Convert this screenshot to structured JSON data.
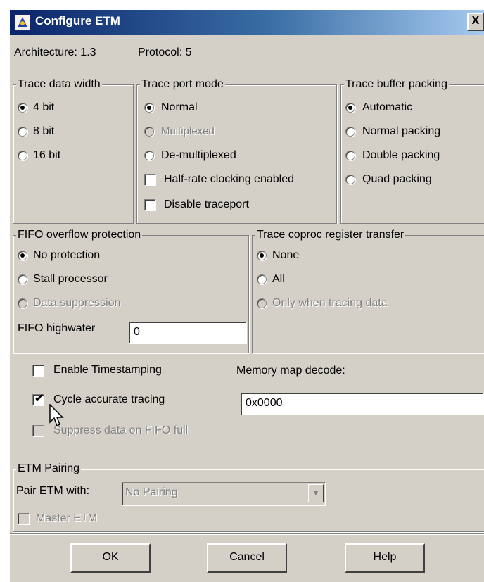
{
  "window": {
    "title": "Configure ETM",
    "close_glyph": "X"
  },
  "info": {
    "architecture": "Architecture: 1.3",
    "protocol": "Protocol: 5"
  },
  "trace_data_width": {
    "legend": "Trace data width",
    "options": [
      "4 bit",
      "8 bit",
      "16 bit"
    ]
  },
  "trace_port_mode": {
    "legend": "Trace port mode",
    "options": [
      "Normal",
      "Multiplexed",
      "De-multiplexed"
    ],
    "half_rate": "Half-rate clocking enabled",
    "disable_traceport": "Disable traceport"
  },
  "trace_buffer_packing": {
    "legend": "Trace buffer packing",
    "options": [
      "Automatic",
      "Normal packing",
      "Double packing",
      "Quad packing"
    ]
  },
  "fifo": {
    "legend": "FIFO overflow protection",
    "options": [
      "No protection",
      "Stall processor",
      "Data suppression"
    ],
    "highwater_label": "FIFO highwater",
    "highwater_value": "0"
  },
  "coproc": {
    "legend": "Trace coproc register transfer",
    "options": [
      "None",
      "All",
      "Only when tracing data"
    ]
  },
  "misc": {
    "enable_timestamping": "Enable Timestamping",
    "cycle_accurate": "Cycle accurate tracing",
    "suppress_data": "Suppress data on FIFO full",
    "memory_map_label": "Memory map decode:",
    "memory_map_value": "0x0000"
  },
  "pairing": {
    "legend": "ETM Pairing",
    "pair_label": "Pair ETM with:",
    "pair_value": "No Pairing",
    "master_etm": "Master ETM"
  },
  "buttons": {
    "ok": "OK",
    "cancel": "Cancel",
    "help": "Help"
  },
  "icons": {
    "app": "etm-app-icon",
    "cursor": "mouse-cursor-icon"
  }
}
